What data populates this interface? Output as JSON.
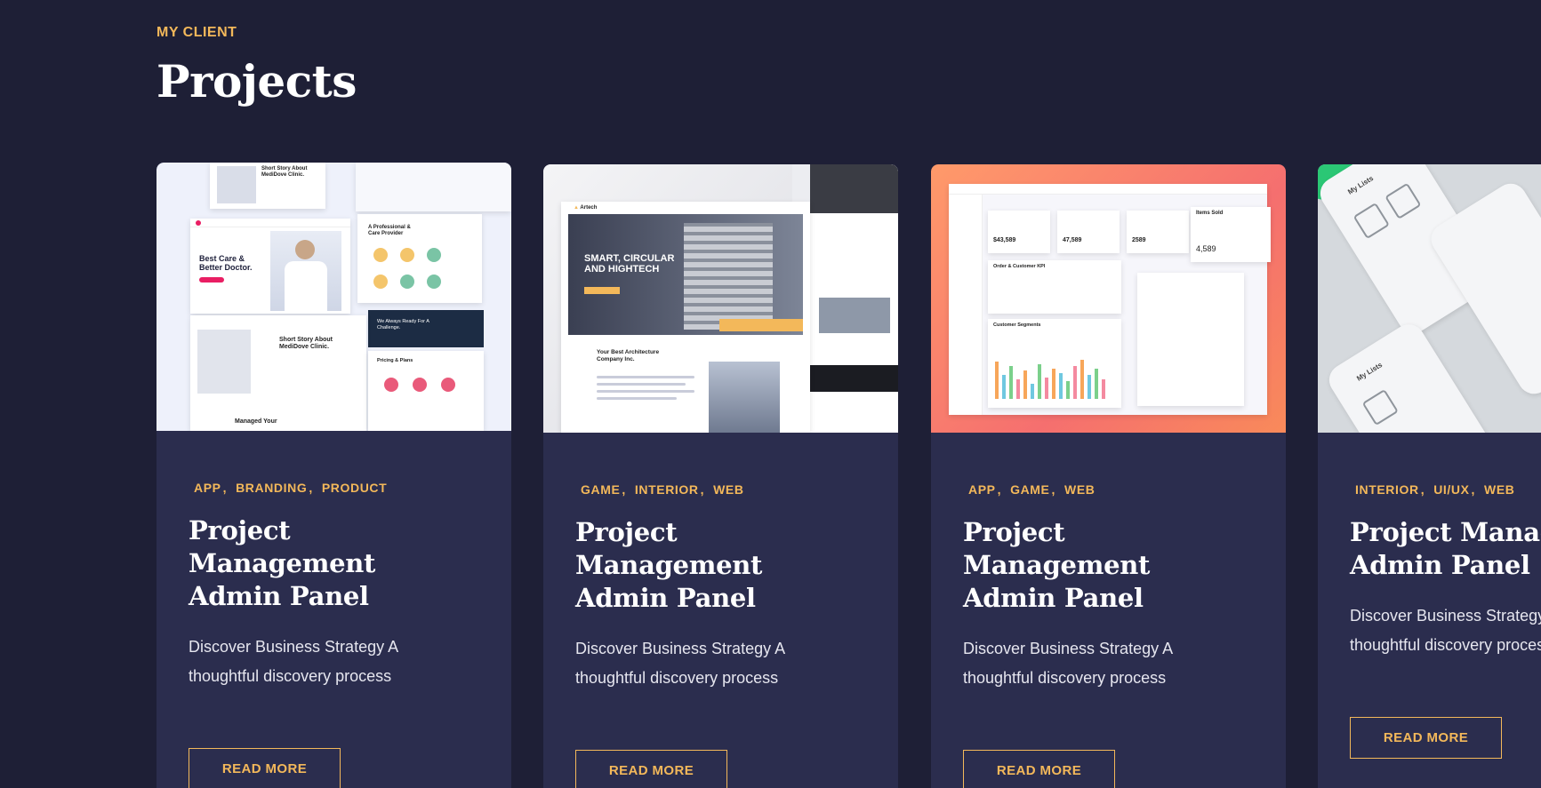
{
  "section": {
    "eyebrow": "MY CLIENT",
    "title": "Projects"
  },
  "colors": {
    "background": "#1e1f36",
    "card": "#2b2d4e",
    "accent": "#f3b85a"
  },
  "cards": [
    {
      "tags": [
        "APP",
        "BRANDING",
        "PRODUCT"
      ],
      "title_line1": "Project Management",
      "title_line2": "Admin Panel",
      "desc_line1": "Discover Business Strategy A",
      "desc_line2": "thoughtful discovery process",
      "button": "READ MORE",
      "thumb": {
        "hero_line1": "Best Care &",
        "hero_line2": "Better Doctor.",
        "story": "Short Story About MediDove Clinic.",
        "provider": "A Professional & Care Provider",
        "challenge": "We Always Ready For A Challenge.",
        "pricing": "Pricing & Plans",
        "managed": "Managed Your"
      }
    },
    {
      "tags": [
        "GAME",
        "INTERIOR",
        "WEB"
      ],
      "title_line1": "Project Management",
      "title_line2": "Admin Panel",
      "desc_line1": "Discover Business Strategy A",
      "desc_line2": "thoughtful discovery process",
      "button": "READ MORE",
      "thumb": {
        "brand": "Artech",
        "hero_line1": "SMART, CIRCULAR",
        "hero_line2": "AND HIGHTECH",
        "about_line1": "Your Best Architecture",
        "about_line2": "Company Inc."
      }
    },
    {
      "tags": [
        "APP",
        "GAME",
        "WEB"
      ],
      "title_line1": "Project Management",
      "title_line2": "Admin Panel",
      "desc_line1": "Discover Business Strategy A",
      "desc_line2": "thoughtful discovery process",
      "button": "READ MORE",
      "thumb": {
        "stat1": "$43,589",
        "stat2": "47,589",
        "stat3": "2589",
        "items_sold_label": "Items Sold",
        "items_sold_value": "4,589",
        "orders_label": "Order & Customer KPI",
        "segments_label": "Customer Segments",
        "bar_values": [
          34,
          22,
          30,
          18,
          26,
          14,
          32,
          20,
          28,
          24,
          16,
          30,
          36,
          22,
          28,
          18
        ]
      }
    },
    {
      "tags": [
        "INTERIOR",
        "UI/UX",
        "WEB"
      ],
      "title_line1": "Project Management",
      "title_line2": "Admin Panel",
      "desc_line1": "Discover Business Strategy A",
      "desc_line2": "thoughtful discovery process",
      "button": "READ MORE",
      "thumb": {
        "list_title1": "My Lists",
        "list_title2": "My Lists"
      }
    }
  ]
}
